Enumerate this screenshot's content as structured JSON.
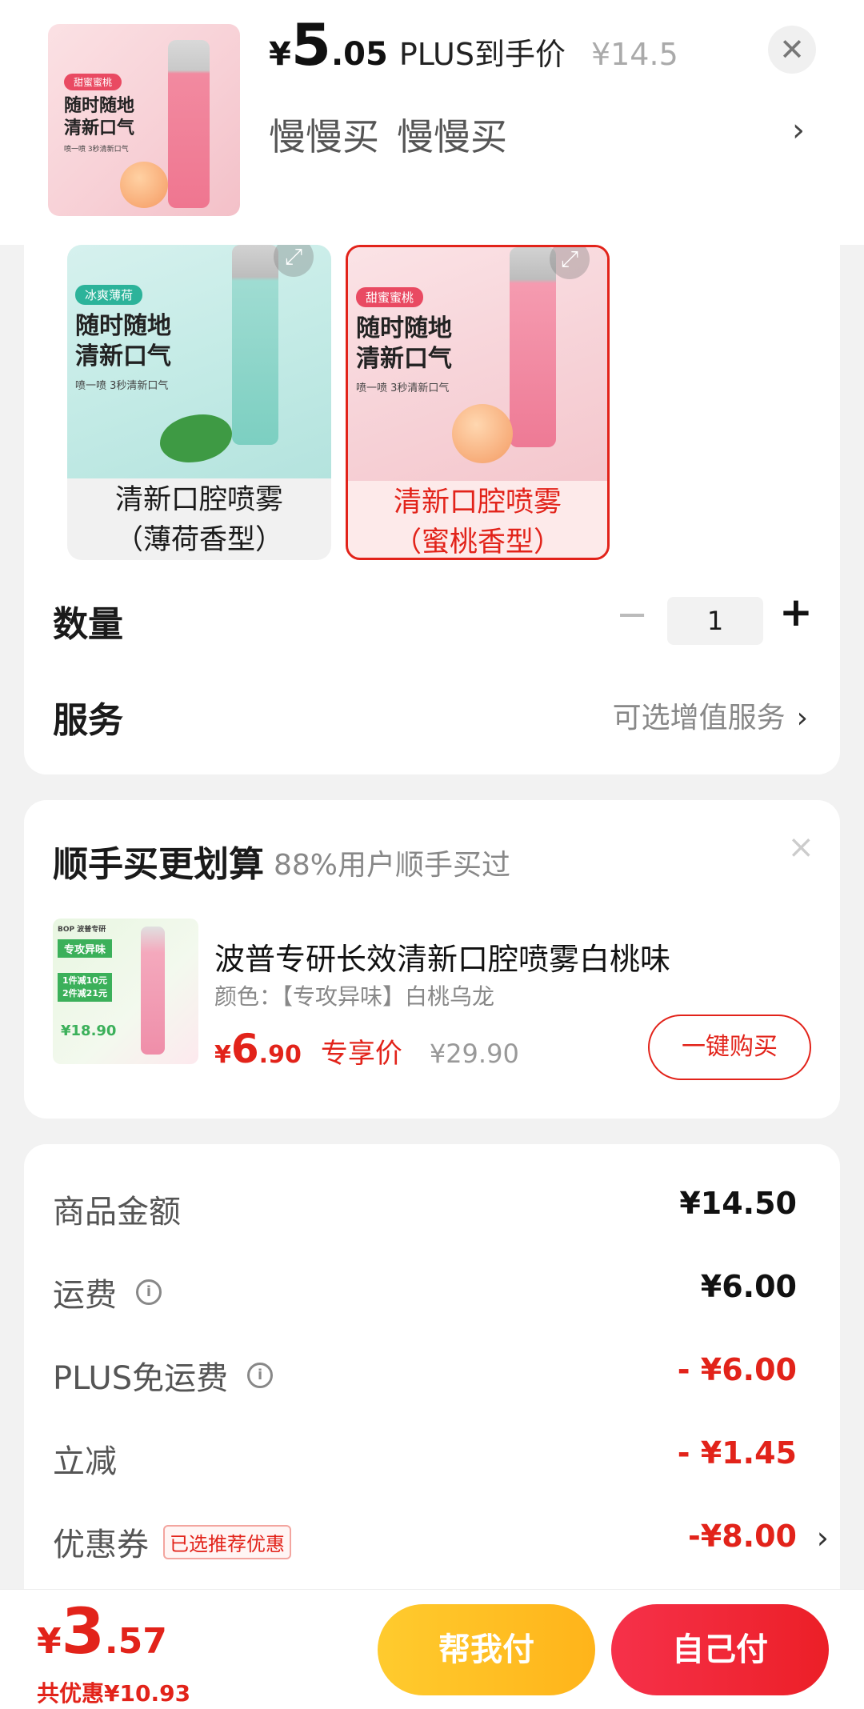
{
  "header": {
    "price_symbol": "¥",
    "price_integer": "5",
    "price_decimal": ".05",
    "price_label": "PLUS到手价",
    "original_price": "¥14.5",
    "close_icon": "close-icon",
    "variant_words": [
      "慢慢买",
      "慢慢买"
    ],
    "chevron": "›",
    "thumb": {
      "tag": "甜蜜蜜桃",
      "title_lines": [
        "随时随地",
        "清新口气"
      ],
      "sub": "喷一喷 3秒清新口气"
    }
  },
  "options": [
    {
      "tag": "冰爽薄荷",
      "title_lines": [
        "随时随地",
        "清新口气"
      ],
      "sub": "喷一喷 3秒清新口气",
      "label_line1": "清新口腔喷雾",
      "label_line2": "（薄荷香型）",
      "selected": false
    },
    {
      "tag": "甜蜜蜜桃",
      "title_lines": [
        "随时随地",
        "清新口气"
      ],
      "sub": "喷一喷 3秒清新口气",
      "label_line1": "清新口腔喷雾",
      "label_line2": "（蜜桃香型）",
      "selected": true
    }
  ],
  "quantity": {
    "label": "数量",
    "minus": "−",
    "value": "1",
    "plus": "+"
  },
  "service": {
    "label": "服务",
    "value": "可选增值服务",
    "chevron": "›"
  },
  "addon": {
    "title": "顺手买更划算",
    "subtitle": "88%用户顺手买过",
    "close": "×",
    "product_name": "波普专研长效清新口腔喷雾白桃味",
    "color": "颜色：【专攻异味】白桃乌龙",
    "price_symbol": "¥",
    "price_integer": "6",
    "price_decimal": ".90",
    "price_label": "专享价",
    "original_price": "¥29.90",
    "button": "一键购买",
    "thumb": {
      "brand": "BOP 波普专研",
      "line1": "专攻异味",
      "line2": "1件减10元",
      "line3": "2件减21元",
      "price": "¥18.90"
    }
  },
  "fees": [
    {
      "label": "商品金额",
      "info": false,
      "value": "¥14.50",
      "red": false
    },
    {
      "label": "运费",
      "info": true,
      "value": "¥6.00",
      "red": false
    },
    {
      "label": "PLUS免运费",
      "info": true,
      "value": "- ¥6.00",
      "red": true
    },
    {
      "label": "立减",
      "info": false,
      "value": "- ¥1.45",
      "red": true
    },
    {
      "label": "优惠券",
      "info": false,
      "tag": "已选推荐优惠",
      "value": "-¥8.00",
      "red": true,
      "chevron": "›"
    }
  ],
  "bottom": {
    "total_symbol": "¥",
    "total_integer": "3",
    "total_decimal": ".57",
    "saving": "共优惠¥10.93",
    "help_pay": "帮我付",
    "self_pay": "自己付"
  },
  "colors": {
    "accent": "#e2231a",
    "yellow": "#ffb41a",
    "bg": "#f2f2f2"
  }
}
